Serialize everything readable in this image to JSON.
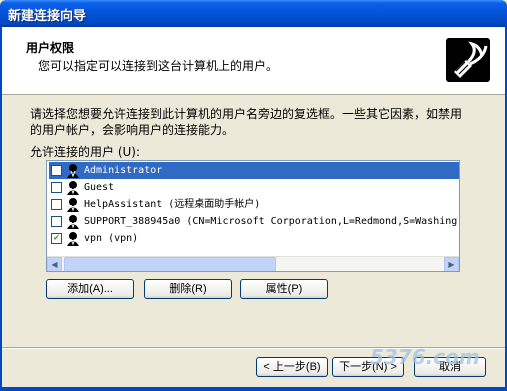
{
  "window": {
    "title": "新建连接向导"
  },
  "header": {
    "title": "用户权限",
    "subtitle": "您可以指定可以连接到这台计算机上的用户。",
    "icon": "network-plug-icon"
  },
  "description": "请选择您想要允许连接到此计算机的用户名旁边的复选框。一些其它因素，如禁用的用户帐户，会影响用户的连接能力。",
  "list_label": "允许连接的用户 (U):",
  "users": [
    {
      "label": "Administrator",
      "checked": false,
      "selected": true
    },
    {
      "label": "Guest",
      "checked": false,
      "selected": false
    },
    {
      "label": "HelpAssistant (远程桌面助手帐户)",
      "checked": false,
      "selected": false
    },
    {
      "label": "SUPPORT_388945a0 (CN=Microsoft Corporation,L=Redmond,S=Washing",
      "checked": false,
      "selected": false
    },
    {
      "label": "vpn (vpn)",
      "checked": true,
      "selected": false
    }
  ],
  "buttons": {
    "add": "添加(A)...",
    "remove": "删除(R)",
    "properties": "属性(P)",
    "back": "< 上一步(B)",
    "next": "下一步(N) >",
    "cancel": "取消"
  },
  "watermark": "5376.com",
  "colors": {
    "title_bar": "#0553D6",
    "selection": "#316AC5",
    "dialog_bg": "#ECE9D8"
  }
}
